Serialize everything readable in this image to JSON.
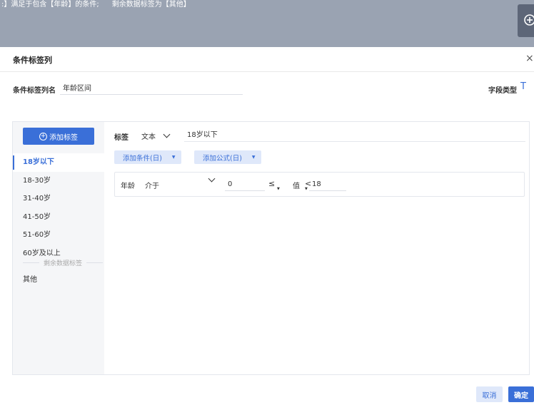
{
  "overlay": {
    "text_left": ":】满足于包含【年龄】的条件;",
    "text_right": "剩余数据标签为【其他】"
  },
  "dialog": {
    "title": "条件标签列",
    "close": "×"
  },
  "name_row": {
    "label": "条件标签列名",
    "value": "年龄区间",
    "field_type_label": "字段类型",
    "field_type_icon": "T"
  },
  "sidebar": {
    "add_button": "添加标签",
    "items": [
      {
        "label": "18岁以下"
      },
      {
        "label": "18-30岁"
      },
      {
        "label": "31-40岁"
      },
      {
        "label": "41-50岁"
      },
      {
        "label": "51-60岁"
      },
      {
        "label": "60岁及以上"
      }
    ],
    "rest_divider": "剩余数据标签",
    "other": "其他"
  },
  "editor": {
    "tag_label": "标签",
    "type_value": "文本",
    "tag_value": "18岁以下",
    "add_condition": "添加条件(日)",
    "add_formula": "添加公式(日)",
    "condition": {
      "field": "年龄",
      "operator": "介于",
      "low_value": "0",
      "cmp1": "≤",
      "value_word": "值",
      "cmp2": "<",
      "high_value": "18"
    }
  },
  "footer": {
    "cancel": "取消",
    "ok": "确定"
  },
  "colors": {
    "primary": "#3a6fd8",
    "light_primary": "#dfe8fa",
    "overlay": "#9aa3b2"
  }
}
